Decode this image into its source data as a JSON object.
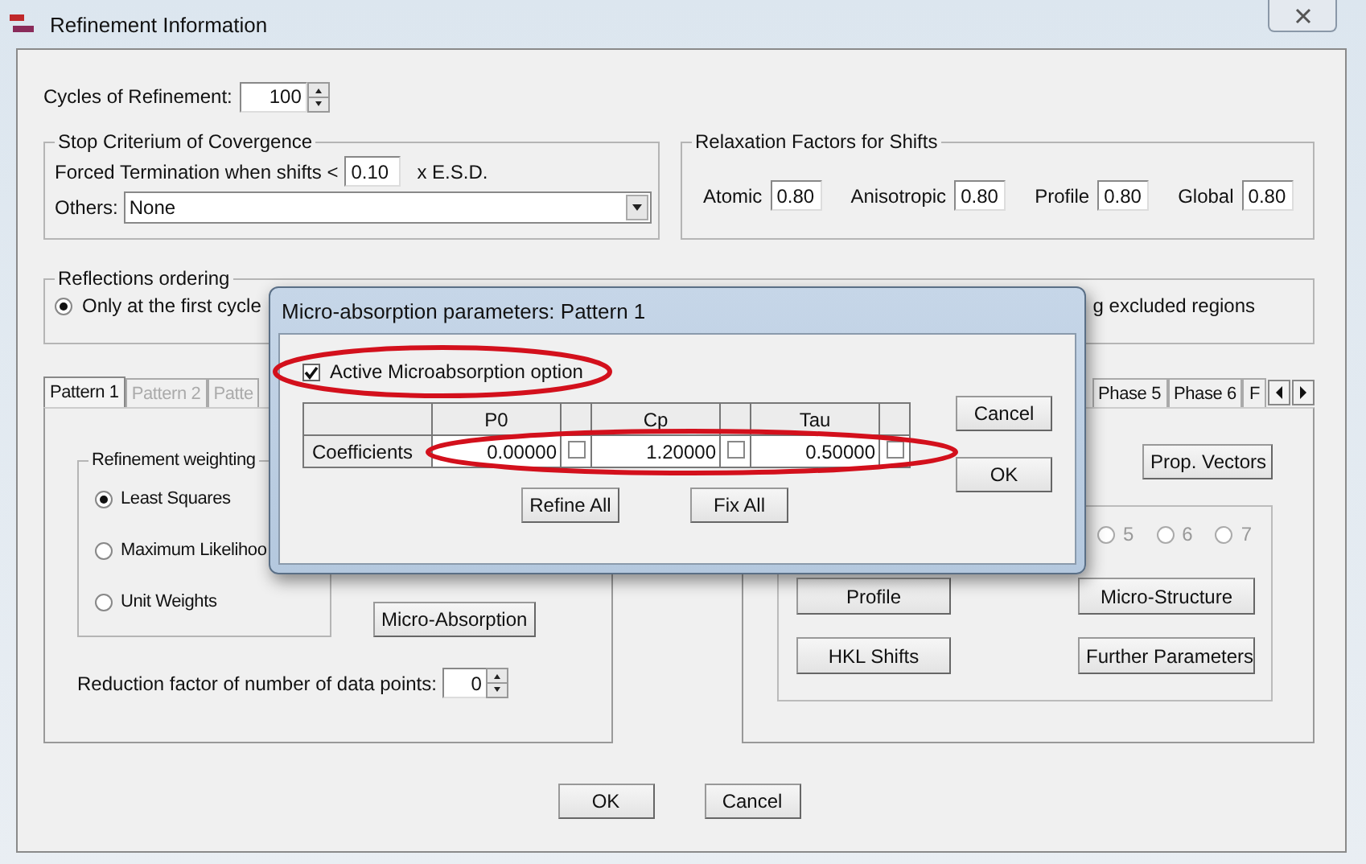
{
  "window": {
    "title": "Refinement Information"
  },
  "cycles": {
    "label": "Cycles of Refinement:",
    "value": "100"
  },
  "stop_criterion": {
    "title": "Stop Criterium of Covergence",
    "forced_label": "Forced Termination when  shifts <",
    "forced_value": "0.10",
    "forced_unit": "x  E.S.D.",
    "others_label": "Others:",
    "others_value": "None"
  },
  "relaxation": {
    "title": "Relaxation Factors for Shifts",
    "fields": [
      {
        "label": "Atomic",
        "value": "0.80"
      },
      {
        "label": "Anisotropic",
        "value": "0.80"
      },
      {
        "label": "Profile",
        "value": "0.80"
      },
      {
        "label": "Global",
        "value": "0.80"
      }
    ]
  },
  "reflections": {
    "title": "Reflections ordering",
    "option": {
      "label": "Only at the first cycle",
      "selected": true
    },
    "right_text": "g excluded regions"
  },
  "pattern_panel": {
    "tabs": [
      {
        "label": "Pattern 1",
        "selected": true,
        "disabled": false
      },
      {
        "label": "Pattern 2",
        "selected": false,
        "disabled": true
      },
      {
        "label": "Patte",
        "selected": false,
        "disabled": true
      }
    ],
    "weighting": {
      "title": "Refinement weighting",
      "options": [
        {
          "label": "Least Squares",
          "selected": true
        },
        {
          "label": "Maximum Likelihoo",
          "selected": false
        },
        {
          "label": "Unit Weights",
          "selected": false
        }
      ]
    },
    "micro_button": "Micro-Absorption",
    "reduction": {
      "label": "Reduction factor of number of data points:",
      "value": "0"
    }
  },
  "phase_panel": {
    "tabs": [
      {
        "label": "Phase 5",
        "selected": false
      },
      {
        "label": "Phase 6",
        "selected": false
      },
      {
        "label": "F",
        "selected": false
      }
    ],
    "prop_button": "Prop. Vectors",
    "phase_radios": [
      {
        "label": "5",
        "selected": false
      },
      {
        "label": "6",
        "selected": false
      },
      {
        "label": "7",
        "selected": false
      }
    ],
    "buttons": [
      "Profile",
      "Micro-Structure",
      "HKL Shifts",
      "Further Parameters"
    ]
  },
  "buttons": [
    "OK",
    "Cancel"
  ],
  "dialog": {
    "title": "Micro-absorption parameters: Pattern 1",
    "active": {
      "label": "Active Microabsorption option",
      "checked": true
    },
    "table": {
      "columns": [
        "P0",
        "Cp",
        "Tau"
      ],
      "rows": [
        {
          "label": "Coefficients",
          "cells": [
            {
              "value": "0.00000",
              "refined": false
            },
            {
              "value": "1.20000",
              "refined": false
            },
            {
              "value": "0.50000",
              "refined": false
            }
          ]
        }
      ]
    },
    "buttons": [
      "Refine All",
      "Fix All"
    ],
    "side_buttons": [
      "Cancel",
      "OK"
    ]
  },
  "annotations": [
    {
      "kind": "ellipse"
    },
    {
      "kind": "ellipse"
    }
  ]
}
